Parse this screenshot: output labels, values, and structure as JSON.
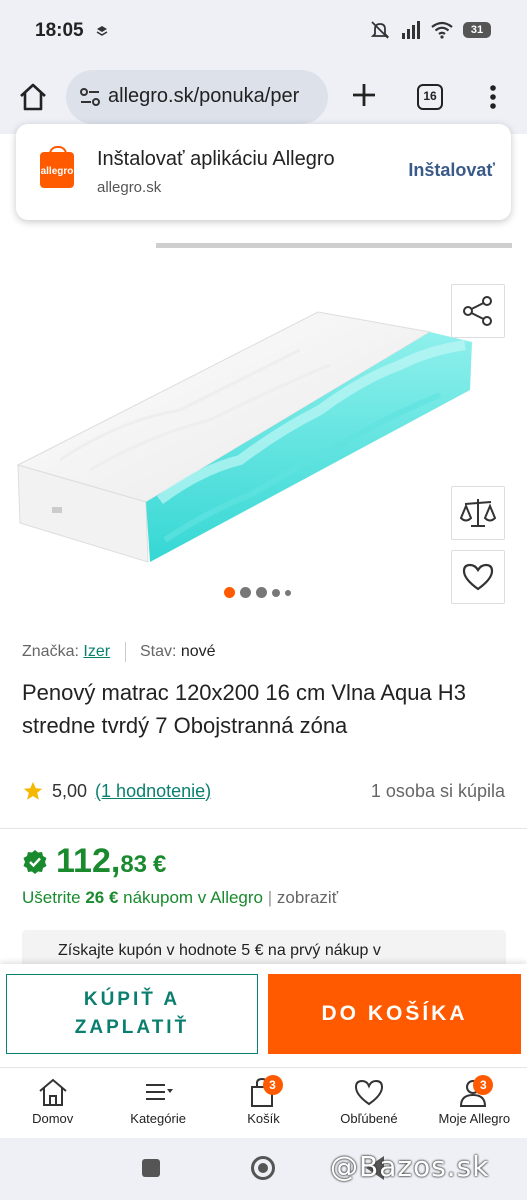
{
  "status_bar": {
    "time": "18:05",
    "battery": "31"
  },
  "browser": {
    "url": "allegro.sk/ponuka/per",
    "tab_count": "16"
  },
  "install_banner": {
    "logo_text": "allegro",
    "title": "Inštalovať aplikáciu Allegro",
    "domain": "allegro.sk",
    "button": "Inštalovať"
  },
  "product": {
    "brand_label": "Značka:",
    "brand": "Izer",
    "condition_label": "Stav:",
    "condition": "nové",
    "title": "Penový matrac 120x200 16 cm Vlna Aqua H3 stredne tvrdý 7 Obojstranná zóna",
    "rating": "5,00",
    "rating_link": "(1 hodnotenie)",
    "bought": "1 osoba si kúpila",
    "gallery": {
      "total_images": 5,
      "active_image": 1
    },
    "price_main": "112,",
    "price_cents": "83",
    "currency": "€",
    "save_prefix": "Ušetrite",
    "save_amount": "26 €",
    "save_suffix": "nákupom v Allegro",
    "save_sep": "|",
    "save_show": "zobraziť",
    "coupon_text": "Získajte kupón v hodnote 5 € na prvý nákup v"
  },
  "buy_bar": {
    "buy_now": "KÚPIŤ A ZAPLATIŤ",
    "add_to_cart": "DO KOŠÍKA"
  },
  "bottom_nav": {
    "items": [
      {
        "label": "Domov"
      },
      {
        "label": "Kategórie"
      },
      {
        "label": "Košík",
        "badge": "3"
      },
      {
        "label": "Obľúbené"
      },
      {
        "label": "Moje Allegro",
        "badge": "3"
      }
    ]
  },
  "watermark": "@Bazos.sk",
  "colors": {
    "accent": "#ff5a00",
    "teal": "#0b7f6f",
    "price_green": "#1a8a2e"
  }
}
